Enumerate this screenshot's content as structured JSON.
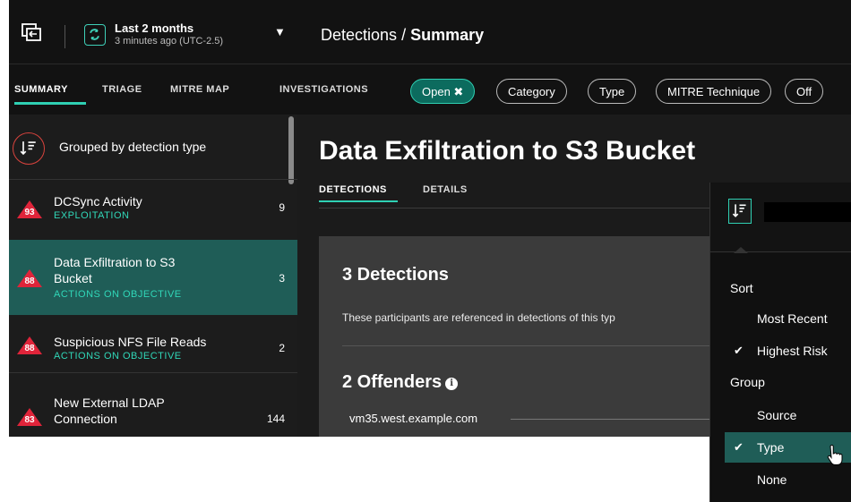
{
  "topbar": {
    "time_range": "Last 2 months",
    "time_updated": "3 minutes ago (UTC-2.5)",
    "breadcrumb_section": "Detections",
    "breadcrumb_sep": "/",
    "breadcrumb_page": "Summary"
  },
  "tabs": [
    "SUMMARY",
    "TRIAGE",
    "MITRE MAP",
    "INVESTIGATIONS"
  ],
  "filters": {
    "open": "Open ✖",
    "category": "Category",
    "type": "Type",
    "mitre": "MITRE Technique",
    "more": "Off"
  },
  "sidebar": {
    "group_label": "Grouped by detection type",
    "items": [
      {
        "risk": "93",
        "title": "DCSync Activity",
        "category": "EXPLOITATION",
        "count": "9"
      },
      {
        "risk": "88",
        "title": "Data Exfiltration to S3 Bucket",
        "category": "ACTIONS ON OBJECTIVE",
        "count": "3"
      },
      {
        "risk": "88",
        "title": "Suspicious NFS File Reads",
        "category": "ACTIONS ON OBJECTIVE",
        "count": "2"
      },
      {
        "risk": "83",
        "title": "New External LDAP Connection",
        "category": "",
        "count": "144"
      }
    ]
  },
  "main": {
    "title": "Data Exfiltration to S3 Bucket",
    "subtabs": [
      "DETECTIONS",
      "DETAILS"
    ],
    "detections_title": "3 Detections",
    "detections_desc": "These participants are referenced in detections of this typ",
    "offenders_title": "2 Offenders",
    "info_glyph": "i",
    "offender_host": "vm35.west.example.com"
  },
  "dropdown": {
    "sort_label": "Sort",
    "sort_options": [
      "Most Recent",
      "Highest Risk"
    ],
    "sort_selected": "Highest Risk",
    "group_label": "Group",
    "group_options": [
      "Source",
      "Type",
      "None"
    ],
    "group_selected": "Type",
    "check_glyph": "✔"
  },
  "colors": {
    "accent": "#2fd0b3",
    "selected_row": "#1f5d57",
    "risk_red": "#e0243a",
    "focus_ring": "#d8433d"
  }
}
